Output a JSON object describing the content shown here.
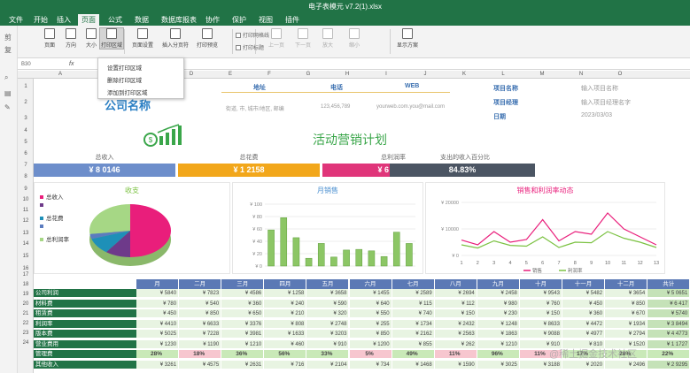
{
  "window": {
    "title": "电子表模元 v7.2(1).xlsx"
  },
  "tabs": [
    "文件",
    "开始",
    "插入",
    "页面",
    "公式",
    "数据",
    "数据库报表",
    "协作",
    "保护",
    "视图",
    "插件"
  ],
  "active_tab": 3,
  "ribbon": {
    "buttons": [
      "页面",
      "方向",
      "大小",
      "打印区域",
      "页面设置",
      "插入分页符",
      "打印预览",
      "上一页",
      "下一页",
      "放大",
      "缩小",
      "显示方案"
    ],
    "checks": [
      "打印网格线",
      "打印标题"
    ],
    "selected_index": 3
  },
  "formula_bar": {
    "name_box": "B30",
    "fx": "fx"
  },
  "left_icons": [
    "剪",
    "复",
    "⌕",
    "▤",
    "✎"
  ],
  "dropdown": {
    "items": [
      "设置打印区域",
      "删除打印区域",
      "添加到打印区域"
    ]
  },
  "columns": [
    "A",
    "B",
    "C",
    "D",
    "E",
    "F",
    "G",
    "H",
    "I",
    "J",
    "K",
    "L",
    "M",
    "N",
    "O"
  ],
  "rows": [
    "1",
    "2",
    "3",
    "4",
    "5",
    "6",
    "7",
    "8",
    "9",
    "10",
    "11",
    "12",
    "13",
    "14",
    "15",
    "16",
    "17",
    "18",
    "19",
    "20",
    "21",
    "22",
    "23",
    "24"
  ],
  "company": {
    "name": "公司名称"
  },
  "info": {
    "headers": [
      "地址",
      "电话",
      "WEB"
    ],
    "values": [
      "街道, 市, 城市/地区, 邮编",
      "123,456,789",
      "yourweb.com.you@mail.com"
    ]
  },
  "project": {
    "labels": [
      "项目名称",
      "项目经理",
      "日期"
    ],
    "values": [
      "输入项目名称",
      "输入项目经理名字",
      "2023/03/03"
    ]
  },
  "plan_title": "活动营销计划",
  "kpis": [
    {
      "label": "总收入",
      "value": "¥ 8 0146",
      "color": "#6d8ecb"
    },
    {
      "label": "总花费",
      "value": "¥ 1 2158",
      "color": "#f2a71b"
    },
    {
      "label": "总利润率",
      "value": "¥ 6 7988",
      "color": "#e0357a"
    },
    {
      "label": "支出的收入百分比",
      "value": "84.83%",
      "color": "#4b5563"
    }
  ],
  "chart_data": [
    {
      "type": "pie",
      "title": "收支",
      "labels": [
        "总收入",
        "",
        "总花费",
        "",
        "总利润率"
      ],
      "values": [
        50,
        10,
        10,
        3,
        27
      ],
      "colors": [
        "#e91e7b",
        "#6e3a8a",
        "#1e90b8",
        "#5b7cbf",
        "#a6d785"
      ]
    },
    {
      "type": "bar",
      "title": "月销售",
      "categories": [
        "1",
        "2",
        "3",
        "4",
        "5",
        "6",
        "7",
        "8",
        "9",
        "10",
        "11",
        "12"
      ],
      "values": [
        5840,
        7823,
        4586,
        1258,
        3658,
        1455,
        2589,
        2694,
        2458,
        1543,
        5482,
        3654
      ],
      "yticks": [
        "¥ 100",
        "¥ 80",
        "¥ 60",
        "¥ 40",
        "¥ 20",
        "¥ 0"
      ]
    },
    {
      "type": "line",
      "title": "销售和利润率动态",
      "x": [
        "1",
        "2",
        "3",
        "4",
        "5",
        "6",
        "7",
        "8",
        "9",
        "10",
        "11",
        "12",
        "13"
      ],
      "yticks": [
        "¥ 20000",
        "¥ 10000",
        "¥ 0"
      ],
      "series": [
        {
          "name": "销售",
          "color": "#e91e7b",
          "values": [
            5800,
            4000,
            9000,
            5000,
            6000,
            13500,
            5500,
            9000,
            8000,
            16000,
            10000,
            7000,
            4000
          ]
        },
        {
          "name": "利润率",
          "color": "#7cc243",
          "values": [
            4000,
            2800,
            5500,
            3800,
            3500,
            7000,
            3000,
            5000,
            4800,
            9000,
            6500,
            5000,
            3000
          ]
        }
      ]
    }
  ],
  "table": {
    "months": [
      "月",
      "二月",
      "三月",
      "四月",
      "五月",
      "六月",
      "七月",
      "八月",
      "九月",
      "十月",
      "十一月",
      "十二月",
      "共计"
    ],
    "rows": [
      {
        "label": "公司利润",
        "values": [
          "¥ 5840",
          "¥ 7823",
          "¥ 4586",
          "¥ 1258",
          "¥ 3658",
          "¥ 1455",
          "¥ 2589",
          "¥ 2694",
          "¥ 2458",
          "¥ 9543",
          "¥ 5482",
          "¥ 3654",
          "¥ 5 0651"
        ]
      },
      {
        "label": "材料费",
        "values": [
          "¥ 780",
          "¥ 540",
          "¥ 360",
          "¥ 240",
          "¥ 590",
          "¥ 640",
          "¥ 115",
          "¥ 112",
          "¥ 980",
          "¥ 760",
          "¥ 450",
          "¥ 850",
          "¥ 6 417"
        ]
      },
      {
        "label": "租赁费",
        "values": [
          "¥ 450",
          "¥ 850",
          "¥ 650",
          "¥ 210",
          "¥ 320",
          "¥ 550",
          "¥ 740",
          "¥ 150",
          "¥ 230",
          "¥ 150",
          "¥ 360",
          "¥ 670",
          "¥ 5740"
        ]
      },
      {
        "label": "利润率",
        "values": [
          "¥ 4410",
          "¥ 6633",
          "¥ 3376",
          "¥ 808",
          "¥ 2748",
          "¥ 255",
          "¥ 1734",
          "¥ 2432",
          "¥ 1248",
          "¥ 8633",
          "¥ 4472",
          "¥ 1934",
          "¥ 3 8494"
        ]
      },
      {
        "label": "版本费",
        "values": [
          "¥ 5025",
          "¥ 7228",
          "¥ 3981",
          "¥ 1633",
          "¥ 3203",
          "¥ 850",
          "¥ 2162",
          "¥ 2563",
          "¥ 1863",
          "¥ 9088",
          "¥ 4977",
          "¥ 2794",
          "¥ 4 4773"
        ]
      },
      {
        "label": "营业费用",
        "values": [
          "¥ 1230",
          "¥ 1190",
          "¥ 1210",
          "¥ 460",
          "¥ 910",
          "¥ 1200",
          "¥ 855",
          "¥ 262",
          "¥ 1210",
          "¥ 910",
          "¥ 810",
          "¥ 1520",
          "¥ 1 1727"
        ]
      },
      {
        "label": "管理费",
        "pct": true,
        "values": [
          "28%",
          "18%",
          "36%",
          "56%",
          "33%",
          "5%",
          "49%",
          "11%",
          "96%",
          "11%",
          "17%",
          "28%",
          "22%"
        ]
      },
      {
        "label": "其他收入",
        "values": [
          "¥ 3261",
          "¥ 4575",
          "¥ 2631",
          "¥ 716",
          "¥ 2104",
          "¥ 734",
          "¥ 1468",
          "¥ 1590",
          "¥ 3025",
          "¥ 3188",
          "¥ 2020",
          "¥ 2496",
          "¥ 2 9295"
        ]
      }
    ]
  },
  "watermark": "@稀土掘金技术社区"
}
